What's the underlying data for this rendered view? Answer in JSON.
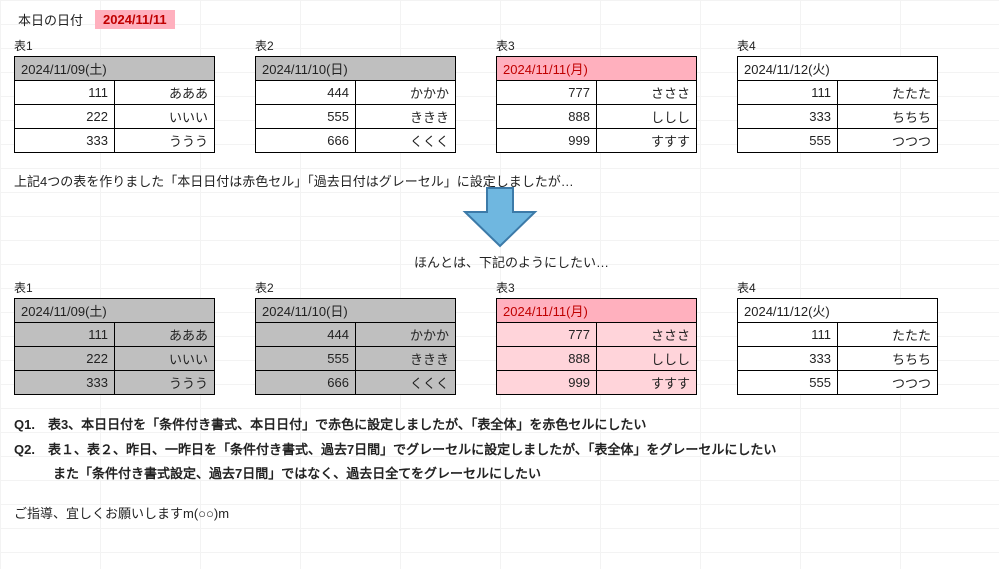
{
  "header": {
    "label": "本日の日付",
    "today": "2024/11/11"
  },
  "upperTables": [
    {
      "caption": "表1",
      "header": "2024/11/09(土)",
      "headerStyle": "gray",
      "bodyStyle": "plain",
      "rows": [
        {
          "num": "111",
          "txt": "あああ"
        },
        {
          "num": "222",
          "txt": "いいい"
        },
        {
          "num": "333",
          "txt": "ううう"
        }
      ]
    },
    {
      "caption": "表2",
      "header": "2024/11/10(日)",
      "headerStyle": "gray",
      "bodyStyle": "plain",
      "rows": [
        {
          "num": "444",
          "txt": "かかか"
        },
        {
          "num": "555",
          "txt": "ききき"
        },
        {
          "num": "666",
          "txt": "くくく"
        }
      ]
    },
    {
      "caption": "表3",
      "header": "2024/11/11(月)",
      "headerStyle": "pink",
      "bodyStyle": "plain",
      "rows": [
        {
          "num": "777",
          "txt": "さささ"
        },
        {
          "num": "888",
          "txt": "ししし"
        },
        {
          "num": "999",
          "txt": "すすす"
        }
      ]
    },
    {
      "caption": "表4",
      "header": "2024/11/12(火)",
      "headerStyle": "plain",
      "bodyStyle": "plain",
      "rows": [
        {
          "num": "111",
          "txt": "たたた"
        },
        {
          "num": "333",
          "txt": "ちちち"
        },
        {
          "num": "555",
          "txt": "つつつ"
        }
      ]
    }
  ],
  "note1": "上記4つの表を作りました「本日日付は赤色セル」「過去日付はグレーセル」に設定しましたが…",
  "note2": "ほんとは、下記のようにしたい…",
  "lowerTables": [
    {
      "caption": "表1",
      "header": "2024/11/09(土)",
      "headerStyle": "gray",
      "bodyStyle": "gray",
      "rows": [
        {
          "num": "111",
          "txt": "あああ"
        },
        {
          "num": "222",
          "txt": "いいい"
        },
        {
          "num": "333",
          "txt": "ううう"
        }
      ]
    },
    {
      "caption": "表2",
      "header": "2024/11/10(日)",
      "headerStyle": "gray",
      "bodyStyle": "gray",
      "rows": [
        {
          "num": "444",
          "txt": "かかか"
        },
        {
          "num": "555",
          "txt": "ききき"
        },
        {
          "num": "666",
          "txt": "くくく"
        }
      ]
    },
    {
      "caption": "表3",
      "header": "2024/11/11(月)",
      "headerStyle": "pink",
      "bodyStyle": "pink",
      "rows": [
        {
          "num": "777",
          "txt": "さささ"
        },
        {
          "num": "888",
          "txt": "ししし"
        },
        {
          "num": "999",
          "txt": "すすす"
        }
      ]
    },
    {
      "caption": "表4",
      "header": "2024/11/12(火)",
      "headerStyle": "plain",
      "bodyStyle": "plain",
      "rows": [
        {
          "num": "111",
          "txt": "たたた"
        },
        {
          "num": "333",
          "txt": "ちちち"
        },
        {
          "num": "555",
          "txt": "つつつ"
        }
      ]
    }
  ],
  "qa": {
    "q1": "Q1.　表3、本日日付を「条件付き書式、本日日付」で赤色に設定しましたが、「表全体」を赤色セルにしたい",
    "q2a": "Q2.　表１、表２、昨日、一昨日を「条件付き書式、過去7日間」でグレーセルに設定しましたが、「表全体」をグレーセルにしたい",
    "q2b": "　　　また「条件付き書式設定、過去7日間」ではなく、過去日全てをグレーセルにしたい"
  },
  "footer": "ご指導、宜しくお願いしますm(○○)m"
}
